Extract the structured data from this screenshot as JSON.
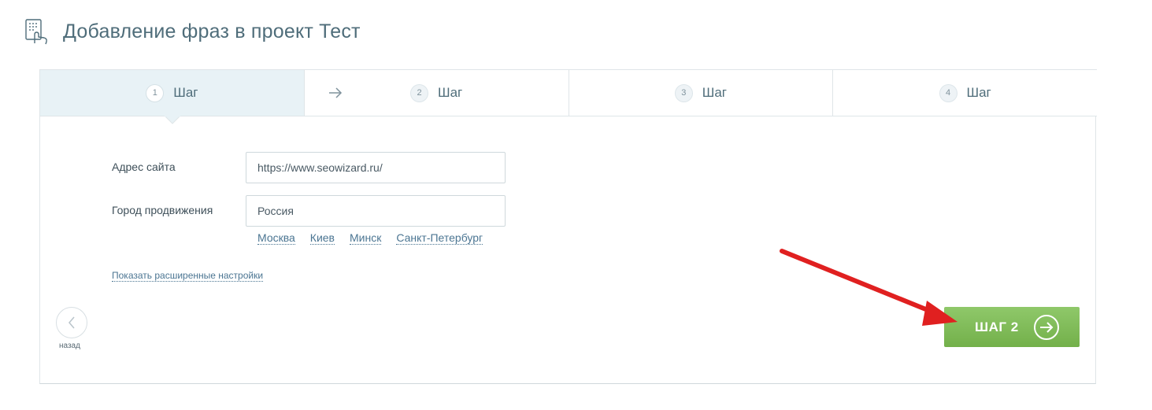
{
  "header": {
    "title": "Добавление фраз в проект Тест",
    "icon": "phrases-list-icon"
  },
  "steps": [
    {
      "number": "1",
      "label": "Шаг",
      "active": true
    },
    {
      "number": "2",
      "label": "Шаг",
      "active": false
    },
    {
      "number": "3",
      "label": "Шаг",
      "active": false
    },
    {
      "number": "4",
      "label": "Шаг",
      "active": false
    }
  ],
  "form": {
    "site_label": "Адрес сайта",
    "site_value": "https://www.seowizard.ru/",
    "city_label": "Город продвижения",
    "city_value": "Россия",
    "city_links": [
      "Москва",
      "Киев",
      "Минск",
      "Санкт-Петербург"
    ],
    "advanced_link": "Показать расширенные настройки"
  },
  "nav": {
    "back_label": "назад",
    "next_label": "ШАГ 2"
  },
  "colors": {
    "accent_green": "#7dbb55",
    "link_blue": "#4b7592",
    "annotation_red": "#e02020"
  }
}
